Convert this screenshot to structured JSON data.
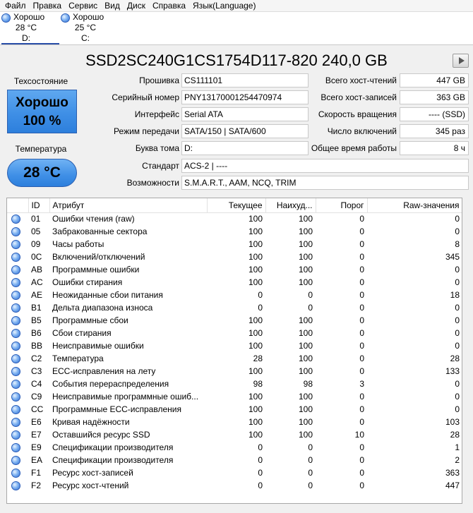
{
  "menu": [
    "Файл",
    "Правка",
    "Сервис",
    "Вид",
    "Диск",
    "Справка",
    "Язык(Language)"
  ],
  "disks": [
    {
      "status": "Хорошо",
      "temp": "28 °C",
      "letter": "D:"
    },
    {
      "status": "Хорошо",
      "temp": "25 °C",
      "letter": "C:"
    }
  ],
  "title": "SSD2SC240G1CS1754D117-820 240,0 GB",
  "health": {
    "label": "Техсостояние",
    "status": "Хорошо",
    "percent": "100 %"
  },
  "temperature": {
    "label": "Температура",
    "value": "28 °C"
  },
  "fields": {
    "firmware": {
      "label": "Прошивка",
      "value": "CS111101"
    },
    "serial": {
      "label": "Серийный номер",
      "value": "PNY13170001254470974"
    },
    "interface": {
      "label": "Интерфейс",
      "value": "Serial ATA"
    },
    "transfer": {
      "label": "Режим передачи",
      "value": "SATA/150 | SATA/600"
    },
    "drive_letter": {
      "label": "Буква тома",
      "value": "D:"
    },
    "standard": {
      "label": "Стандарт",
      "value": "ACS-2 | ----"
    },
    "features": {
      "label": "Возможности",
      "value": "S.M.A.R.T., AAM, NCQ, TRIM"
    },
    "host_reads": {
      "label": "Всего хост-чтений",
      "value": "447 GB"
    },
    "host_writes": {
      "label": "Всего хост-записей",
      "value": "363 GB"
    },
    "rotation": {
      "label": "Скорость вращения",
      "value": "---- (SSD)"
    },
    "power_count": {
      "label": "Число включений",
      "value": "345 раз"
    },
    "power_hours": {
      "label": "Общее время работы",
      "value": "8 ч"
    }
  },
  "table": {
    "headers": [
      "ID",
      "Атрибут",
      "Текущее",
      "Наихуд...",
      "Порог",
      "Raw-значения"
    ],
    "rows": [
      [
        "01",
        "Ошибки чтения (raw)",
        "100",
        "100",
        "0",
        "0"
      ],
      [
        "05",
        "Забракованные сектора",
        "100",
        "100",
        "0",
        "0"
      ],
      [
        "09",
        "Часы работы",
        "100",
        "100",
        "0",
        "8"
      ],
      [
        "0C",
        "Включений/отключений",
        "100",
        "100",
        "0",
        "345"
      ],
      [
        "AB",
        "Программные ошибки",
        "100",
        "100",
        "0",
        "0"
      ],
      [
        "AC",
        "Ошибки стирания",
        "100",
        "100",
        "0",
        "0"
      ],
      [
        "AE",
        "Неожиданные сбои питания",
        "0",
        "0",
        "0",
        "18"
      ],
      [
        "B1",
        "Дельта диапазона износа",
        "0",
        "0",
        "0",
        "0"
      ],
      [
        "B5",
        "Программные сбои",
        "100",
        "100",
        "0",
        "0"
      ],
      [
        "B6",
        "Сбои стирания",
        "100",
        "100",
        "0",
        "0"
      ],
      [
        "BB",
        "Неисправимые ошибки",
        "100",
        "100",
        "0",
        "0"
      ],
      [
        "C2",
        "Температура",
        "28",
        "100",
        "0",
        "28"
      ],
      [
        "C3",
        "ECC-исправления на лету",
        "100",
        "100",
        "0",
        "133"
      ],
      [
        "C4",
        "События перераспределения",
        "98",
        "98",
        "3",
        "0"
      ],
      [
        "C9",
        "Неисправимые программные ошиб...",
        "100",
        "100",
        "0",
        "0"
      ],
      [
        "CC",
        "Программные ECC-исправления",
        "100",
        "100",
        "0",
        "0"
      ],
      [
        "E6",
        "Кривая надёжности",
        "100",
        "100",
        "0",
        "103"
      ],
      [
        "E7",
        "Оставшийся ресурс SSD",
        "100",
        "100",
        "10",
        "28"
      ],
      [
        "E9",
        "Спецификации производителя",
        "0",
        "0",
        "0",
        "1"
      ],
      [
        "EA",
        "Спецификации производителя",
        "0",
        "0",
        "0",
        "2"
      ],
      [
        "F1",
        "Ресурс хост-записей",
        "0",
        "0",
        "0",
        "363"
      ],
      [
        "F2",
        "Ресурс хост-чтений",
        "0",
        "0",
        "0",
        "447"
      ]
    ]
  }
}
